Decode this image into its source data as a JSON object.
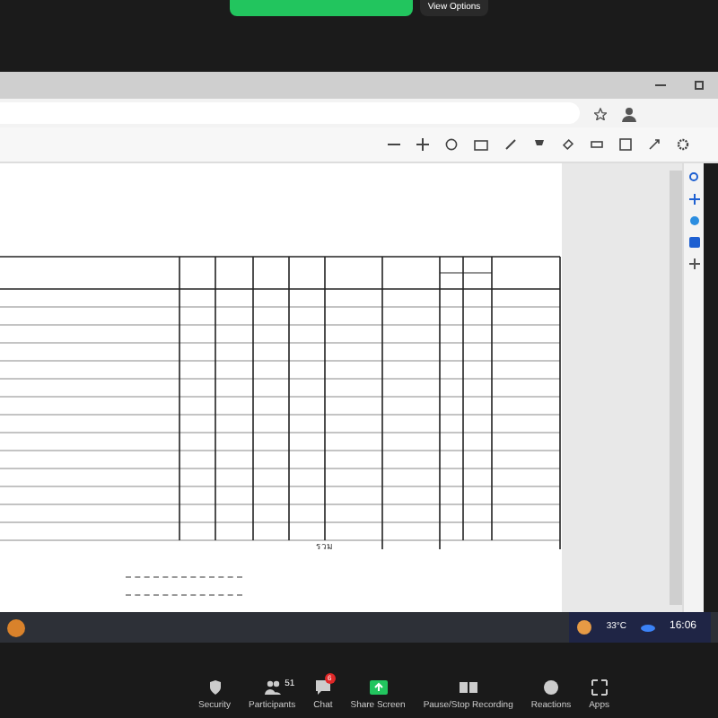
{
  "view_options": {
    "label": "View Options"
  },
  "document": {
    "total_label": "รวม"
  },
  "taskbar": {
    "weather": "33°C",
    "time": "16:06"
  },
  "meeting_toolbar": [
    {
      "kind": "shield",
      "label": "Security"
    },
    {
      "kind": "people",
      "label": "Participants",
      "count": "51"
    },
    {
      "kind": "chat",
      "label": "Chat",
      "badge": "6"
    },
    {
      "kind": "share",
      "label": "Share Screen"
    },
    {
      "kind": "pause",
      "label": "Pause/Stop Recording"
    },
    {
      "kind": "smile",
      "label": "Reactions"
    },
    {
      "kind": "apps",
      "label": "Apps"
    }
  ]
}
